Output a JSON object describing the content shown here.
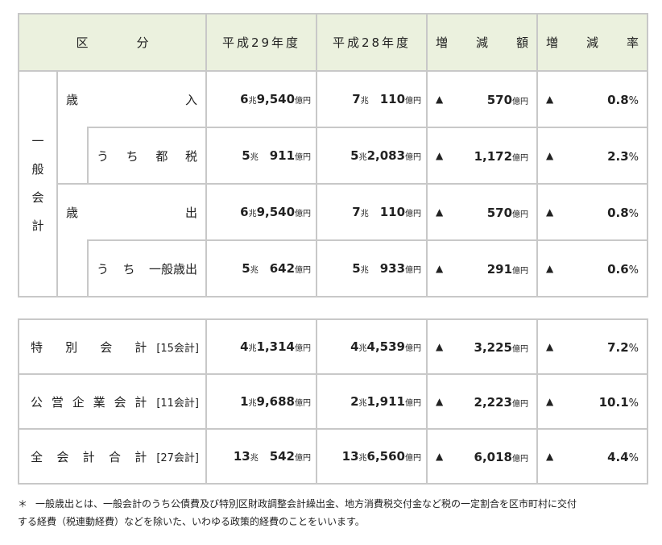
{
  "header": {
    "category": [
      "区",
      "分"
    ],
    "fy29": "平成29年度",
    "fy28": "平成28年度",
    "change_amount": [
      "増",
      "減",
      "額"
    ],
    "change_rate": [
      "増",
      "減",
      "率"
    ]
  },
  "general_account_label": [
    "一",
    "般",
    "会",
    "計"
  ],
  "units": {
    "cho": "兆",
    "oku": "億円",
    "pct": "%",
    "decrease_mark": "▲"
  },
  "rows_general": [
    {
      "label": [
        "歳",
        "入"
      ],
      "fy29": [
        "6",
        "9,540"
      ],
      "fy28": [
        "7",
        "110"
      ],
      "diff": "570",
      "rate": "0.8"
    },
    {
      "label": [
        "う",
        "ち",
        "都",
        "税"
      ],
      "fy29": [
        "5",
        "911"
      ],
      "fy28": [
        "5",
        "2,083"
      ],
      "diff": "1,172",
      "rate": "2.3"
    },
    {
      "label": [
        "歳",
        "出"
      ],
      "fy29": [
        "6",
        "9,540"
      ],
      "fy28": [
        "7",
        "110"
      ],
      "diff": "570",
      "rate": "0.8"
    },
    {
      "label": [
        "う",
        "ち",
        "一般歳出"
      ],
      "fy29": [
        "5",
        "642"
      ],
      "fy28": [
        "5",
        "933"
      ],
      "diff": "291",
      "rate": "0.6"
    }
  ],
  "rows_other": [
    {
      "label": [
        "特",
        "別",
        "会",
        "計"
      ],
      "count": "[15会計]",
      "fy29": [
        "4",
        "1,314"
      ],
      "fy28": [
        "4",
        "4,539"
      ],
      "diff": "3,225",
      "rate": "7.2"
    },
    {
      "label": [
        "公",
        "営",
        "企",
        "業",
        "会",
        "計"
      ],
      "count": "[11会計]",
      "fy29": [
        "1",
        "9,688"
      ],
      "fy28": [
        "2",
        "1,911"
      ],
      "diff": "2,223",
      "rate": "10.1"
    },
    {
      "label": [
        "全",
        "会",
        "計",
        "合",
        "計"
      ],
      "count": "[27会計]",
      "fy29": [
        "13",
        "542"
      ],
      "fy28": [
        "13",
        "6,560"
      ],
      "diff": "6,018",
      "rate": "4.4"
    }
  ],
  "note": {
    "mark": "＊",
    "line1": "一般歳出とは、一般会計のうち公債費及び特別区財政調整会計繰出金、地方消費税交付金など税の一定割合を区市町村に交付",
    "line2": "する経費（税連動経費）などを除いた、いわゆる政策的経費のことをいいます。"
  }
}
